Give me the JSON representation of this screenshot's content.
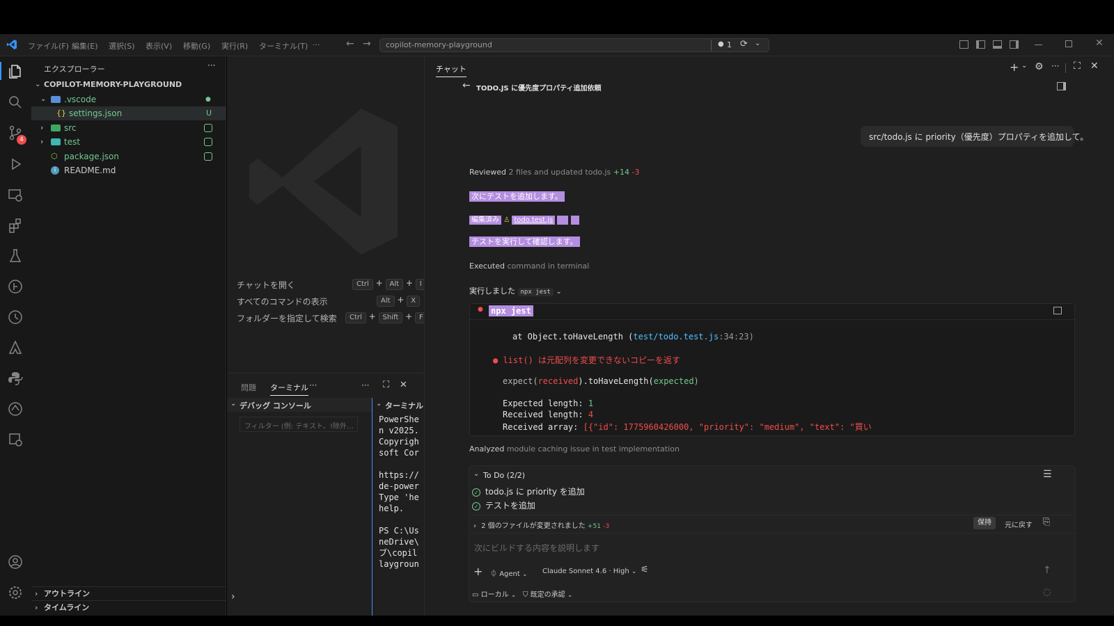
{
  "titlebar": {
    "menus": [
      "ファイル(F)",
      "編集(E)",
      "選択(S)",
      "表示(V)",
      "移動(G)",
      "実行(R)",
      "ターミナル(T)",
      "···"
    ],
    "search_text": "copilot-memory-playground",
    "badge_count": "1"
  },
  "sidebar": {
    "title": "エクスプローラー",
    "root": "COPILOT-MEMORY-PLAYGROUND",
    "items": [
      {
        "label": ".vscode",
        "badge": "●",
        "color": "#73c991"
      },
      {
        "label": "settings.json",
        "badge": "U",
        "color": "#73c991"
      },
      {
        "label": "src",
        "badge": "■",
        "color": "#73c991"
      },
      {
        "label": "test",
        "badge": "■",
        "color": "#73c991"
      },
      {
        "label": "package.json",
        "badge": "■",
        "color": "#73c991"
      },
      {
        "label": "README.md",
        "badge": "",
        "color": "#cccccc"
      }
    ],
    "outline": "アウトライン",
    "timeline": "タイムライン"
  },
  "editor": {
    "shortcuts": [
      {
        "label": "チャットを開く",
        "keys": [
          "Ctrl",
          "+",
          "Alt",
          "+",
          "I"
        ]
      },
      {
        "label": "すべてのコマンドの表示",
        "keys": [
          "Alt",
          "+",
          "X"
        ]
      },
      {
        "label": "フォルダーを指定して検索",
        "keys": [
          "Ctrl",
          "+",
          "Shift",
          "+",
          "F"
        ]
      }
    ]
  },
  "panel": {
    "tabs": [
      "問題",
      "ターミナル",
      "···"
    ],
    "debug_title": "デバッグ コンソール",
    "filter_placeholder": "フィルター (例: テキスト、!除外…",
    "terminal_title": "ターミナル",
    "terminal_lines": [
      "PowerShe",
      "n v2025.",
      "Copyrigh",
      "soft Cor",
      "",
      "https://",
      "de-power",
      "Type 'he",
      "help.",
      "",
      "PS C:\\Us",
      "neDrive\\",
      "ブ\\copil",
      "laygroun"
    ]
  },
  "chat": {
    "tab": "チャット",
    "title": "TODO.JS に優先度プロパティ追加依頼",
    "user_message": "src/todo.js に priority（優先度）プロパティを追加して。",
    "reviewed_prefix": "Reviewed",
    "reviewed_rest": "2 files and updated todo.js",
    "reviewed_plus": "+14",
    "reviewed_minus": "-3",
    "hl_line1": "次にテストを追加します。",
    "hl_edit_label": "編集済み",
    "hl_edit_file": "todo.test.js",
    "hl_line3": "テストを実行して確認します。",
    "executed_prefix": "Executed",
    "executed_rest": "command in terminal",
    "ran_label": "実行しました",
    "ran_cmd": "npx jest",
    "term_cmd": "npx jest",
    "term_at": "at Object.toHaveLength (",
    "term_path": "test/todo.test.js",
    "term_loc": ":34:23)",
    "term_fail": "● list() は元配列を変更できないコピーを返す",
    "term_expect_a": "expect(",
    "term_expect_b": "received",
    "term_expect_c": ").toHaveLength(",
    "term_expect_d": "expected",
    "term_expect_e": ")",
    "term_expected_label": "Expected length:",
    "term_expected_val": "1",
    "term_received_label": "Received length:",
    "term_received_val": "4",
    "term_array_label": "Received array:",
    "term_array_val": "[{\"id\": 1775960426000, \"priority\": \"medium\", \"text\": \"買い",
    "analyzed_prefix": "Analyzed",
    "analyzed_rest": "module caching issue in test implementation",
    "todo_title": "To Do (2/2)",
    "todo_items": [
      "todo.js に priority を追加",
      "テストを追加"
    ],
    "changed_files": "2 個のファイルが変更されました",
    "changed_plus": "+51",
    "changed_minus": "-3",
    "keep_label": "保持",
    "undo_label": "元に戻す",
    "input_placeholder": "次にビルドする内容を説明します",
    "agent_label": "Agent",
    "model_label": "Claude Sonnet 4.6 · High",
    "local_label": "ローカル",
    "approval_label": "既定の承認"
  },
  "colors": {
    "accent": "#3794ff",
    "highlight": "#b48ee0",
    "green": "#73c991",
    "red": "#f14c4c"
  }
}
